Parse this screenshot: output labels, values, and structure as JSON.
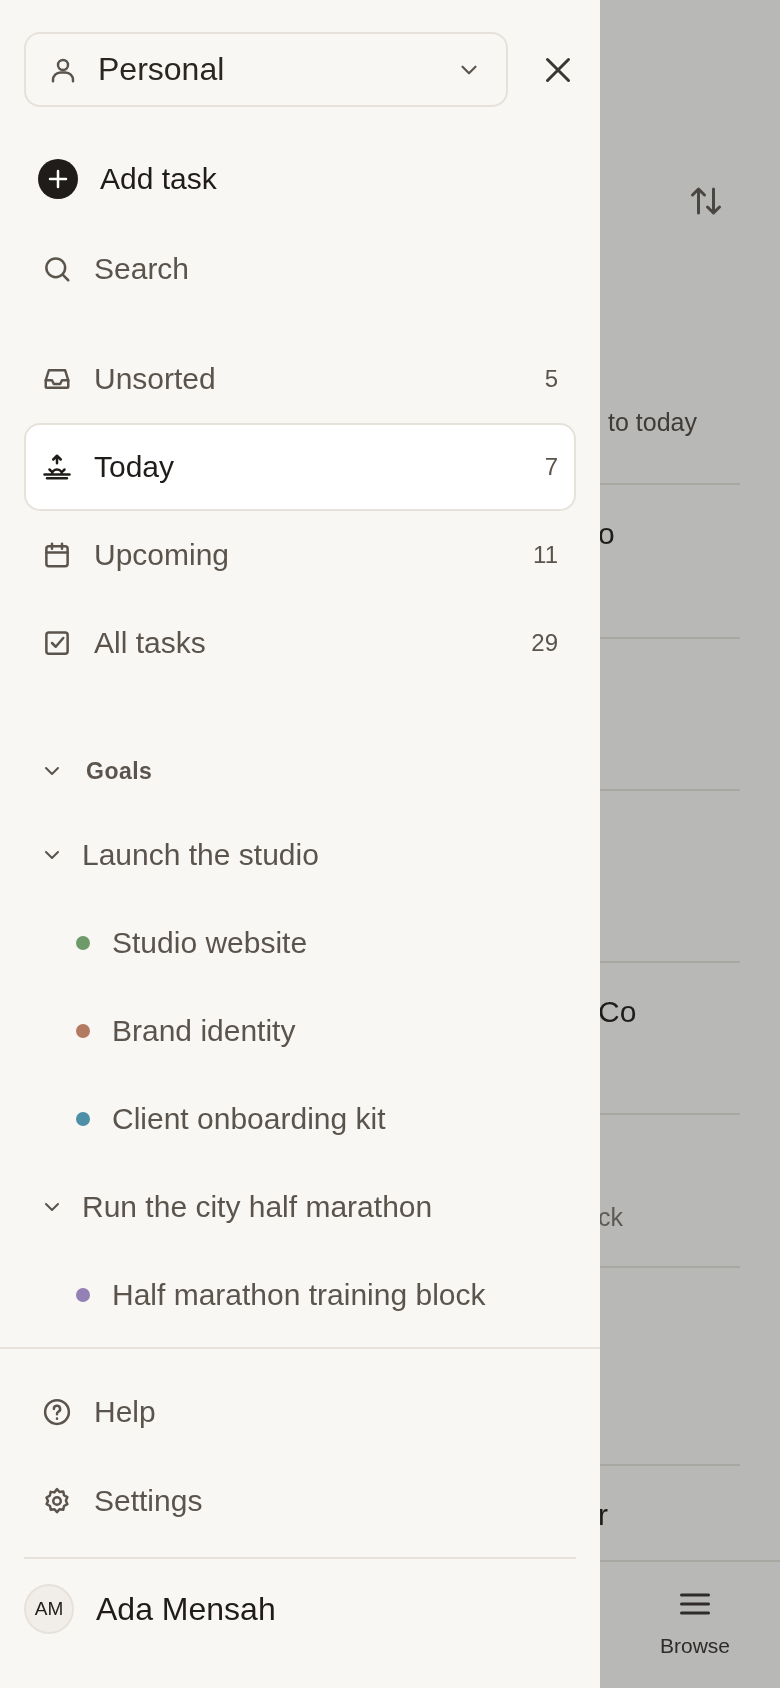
{
  "workspace_switcher": {
    "label": "Personal"
  },
  "add_task": {
    "label": "Add task"
  },
  "search": {
    "label": "Search"
  },
  "nav": [
    {
      "label": "Unsorted",
      "count": "5",
      "selected": false
    },
    {
      "label": "Today",
      "count": "7",
      "selected": true
    },
    {
      "label": "Upcoming",
      "count": "11",
      "selected": false
    },
    {
      "label": "All tasks",
      "count": "29",
      "selected": false
    }
  ],
  "goals": {
    "label": "Goals",
    "expanded": true,
    "children": [
      {
        "label": "Launch the studio",
        "expanded": true,
        "children": [
          {
            "label": "Studio website",
            "color": "#6e9a6a"
          },
          {
            "label": "Brand identity",
            "color": "#b27a60"
          },
          {
            "label": "Client onboarding kit",
            "color": "#4c8fa6"
          }
        ]
      },
      {
        "label": "Run the city half marathon",
        "expanded": true,
        "children": [
          {
            "label": "Half marathon training block",
            "color": "#9380b4"
          }
        ]
      }
    ]
  },
  "footer_links": [
    {
      "label": "Help"
    },
    {
      "label": "Settings"
    }
  ],
  "user": {
    "initials": "AM",
    "name": "Ada Mensah"
  },
  "background": {
    "header_text": "to today",
    "rows": [
      {
        "text": "o",
        "kind": "title"
      },
      {
        "kind": "empty"
      },
      {
        "kind": "empty"
      },
      {
        "text": "Co",
        "kind": "title"
      },
      {
        "text": "ck",
        "kind": "sub"
      },
      {
        "kind": "empty"
      },
      {
        "text": "r",
        "kind": "title"
      }
    ],
    "tab": {
      "label": "Browse"
    }
  }
}
